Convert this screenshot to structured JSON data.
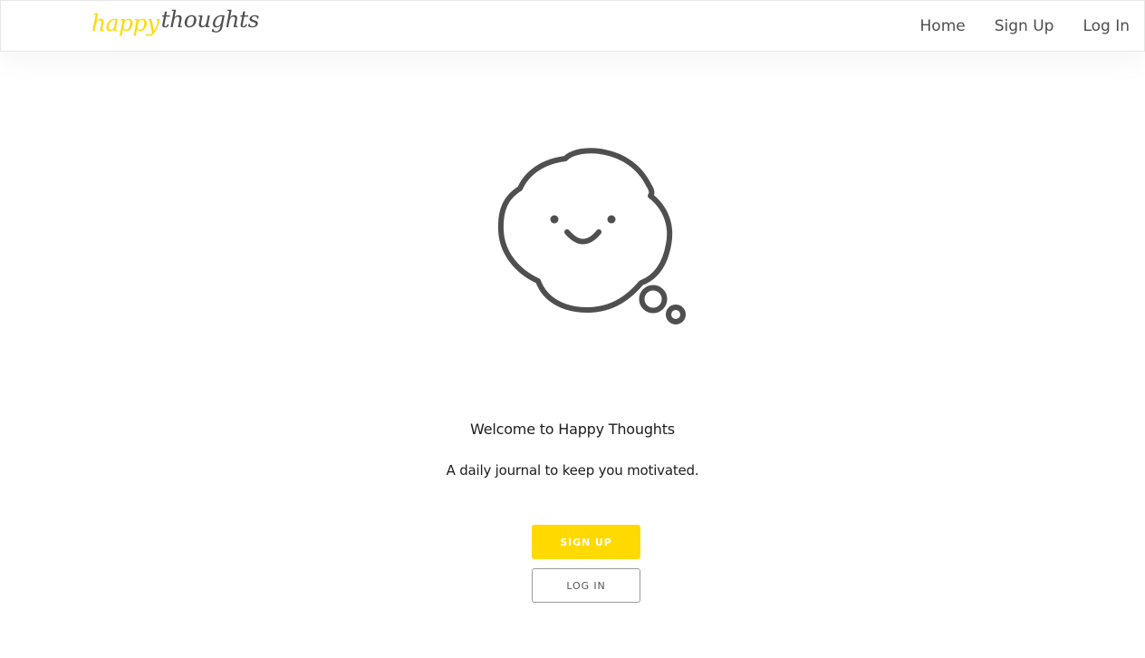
{
  "brand": {
    "word1": "happy",
    "word2": "thoughts"
  },
  "nav": {
    "items": [
      {
        "label": "Home"
      },
      {
        "label": "Sign Up"
      },
      {
        "label": "Log In"
      }
    ]
  },
  "hero": {
    "icon": "smiling-thought-bubble",
    "welcome": "Welcome to Happy Thoughts",
    "tagline": "A daily journal to keep you motivated.",
    "signup_label": "SIGN UP",
    "login_label": "LOG IN"
  },
  "colors": {
    "accent": "#ffd900",
    "icon_stroke": "#4f4f4f",
    "text": "#1c1c1c"
  }
}
